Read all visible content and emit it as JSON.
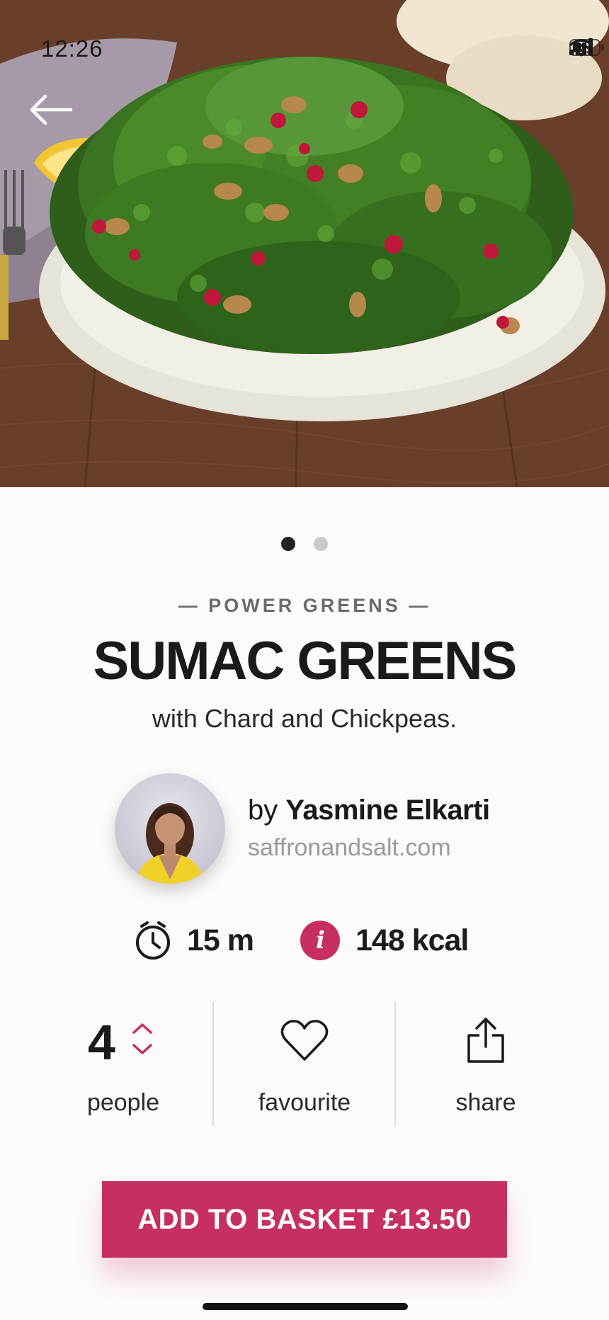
{
  "status_bar": {
    "time": "12:26"
  },
  "carousel": {
    "pages": 2,
    "active": 1
  },
  "recipe": {
    "category": "— POWER GREENS —",
    "title": "SUMAC GREENS",
    "subtitle": "with Chard and Chickpeas."
  },
  "author": {
    "by_prefix": "by ",
    "name": "Yasmine Elkarti",
    "website": "saffronandsalt.com"
  },
  "stats": {
    "time": "15 m",
    "calories": "148 kcal",
    "info_icon_glyph": "i"
  },
  "actions": {
    "people_count": "4",
    "people_label": "people",
    "favourite_label": "favourite",
    "share_label": "share"
  },
  "cta": {
    "label": "ADD TO BASKET £13.50"
  },
  "colors": {
    "accent": "#c62f5e",
    "text": "#1a1a1a",
    "muted": "#9a9a9a",
    "background": "#fcfbf9"
  },
  "icons": [
    "back-arrow-icon",
    "signal-icon",
    "wifi-icon",
    "battery-icon",
    "clock-icon",
    "info-icon",
    "stepper-chevrons-icon",
    "heart-icon",
    "share-icon"
  ]
}
